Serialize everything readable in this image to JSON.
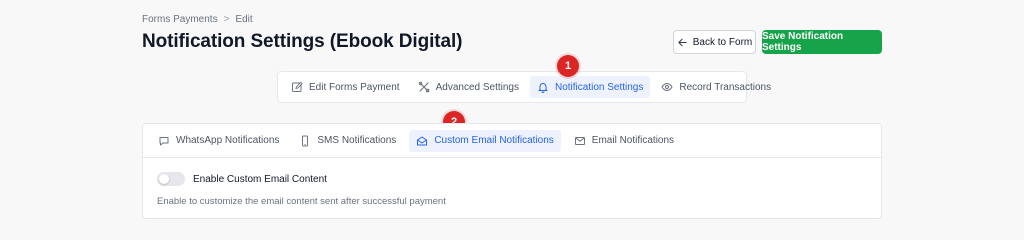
{
  "breadcrumb": {
    "parent": "Forms Payments",
    "separator": ">",
    "current": "Edit"
  },
  "page": {
    "title": "Notification Settings (Ebook Digital)"
  },
  "actions": {
    "back_label": "Back to Form",
    "save_label": "Save Notification Settings"
  },
  "main_tabs": [
    {
      "label": "Edit Forms Payment",
      "icon": "edit-icon"
    },
    {
      "label": "Advanced Settings",
      "icon": "tools-icon"
    },
    {
      "label": "Notification Settings",
      "icon": "bell-icon",
      "active": true
    },
    {
      "label": "Record Transactions",
      "icon": "eye-icon"
    }
  ],
  "sub_tabs": [
    {
      "label": "WhatsApp Notifications",
      "icon": "chat-icon"
    },
    {
      "label": "SMS Notifications",
      "icon": "phone-icon"
    },
    {
      "label": "Custom Email Notifications",
      "icon": "envelope-open-icon",
      "active": true
    },
    {
      "label": "Email Notifications",
      "icon": "mail-icon"
    }
  ],
  "custom_email": {
    "toggle_label": "Enable Custom Email Content",
    "toggle_on": false,
    "help_text": "Enable to customize the email content sent after successful payment"
  },
  "annotations": [
    {
      "label": "1"
    },
    {
      "label": "2"
    }
  ],
  "colors": {
    "accent": "#2563eb",
    "save": "#16a34a",
    "badge": "#dc2626"
  }
}
